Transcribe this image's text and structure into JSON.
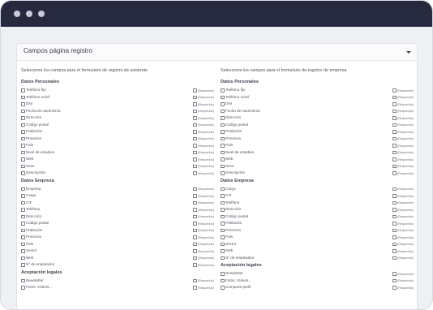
{
  "panel": {
    "title": "Campos página registro"
  },
  "required_label": "(Requerido)",
  "left": {
    "intro": "Seleccione los campos para el formulario de registro de asistente",
    "sections": [
      {
        "title": "Datos Personales",
        "fields": [
          "Teléfono fijo",
          "Teléfono móvil",
          "DNI",
          "Fecha de nacimiento",
          "Dirección",
          "Código postal",
          "Población",
          "Provincia",
          "País",
          "Nivel de estudios",
          "Web",
          "Sexo",
          "Descripción"
        ]
      },
      {
        "title": "Datos Empresa",
        "fields": [
          "Empresa",
          "Cargo",
          "CIF",
          "Teléfono",
          "Dirección",
          "Código postal",
          "Población",
          "Provincia",
          "País",
          "Sector",
          "Web",
          "Nº de empleados"
        ]
      },
      {
        "title": "Aceptación legales",
        "fields": [
          "Newsletter",
          "Fotos, Vídeos..."
        ]
      }
    ]
  },
  "right": {
    "intro": "Seleccione los campos para el formulario de registro de empresa",
    "sections": [
      {
        "title": "Datos Personales",
        "fields": [
          "Teléfono fijo",
          "Teléfono móvil",
          "DNI",
          "Fecha de nacimiento",
          "Dirección",
          "Código postal",
          "Población",
          "Provincia",
          "País",
          "Nivel de estudios",
          "Web",
          "Sexo",
          "Descripción"
        ]
      },
      {
        "title": "Datos Empresa",
        "fields": [
          "Cargo",
          "CIF",
          "Teléfono",
          "Dirección",
          "Código postal",
          "Población",
          "Provincia",
          "País",
          "Sector",
          "Web",
          "Nº de empleados"
        ]
      },
      {
        "title": "Aceptación legales",
        "fields": [
          "Newsletter",
          "Fotos, Vídeos...",
          "Compartir perfil"
        ]
      }
    ]
  }
}
